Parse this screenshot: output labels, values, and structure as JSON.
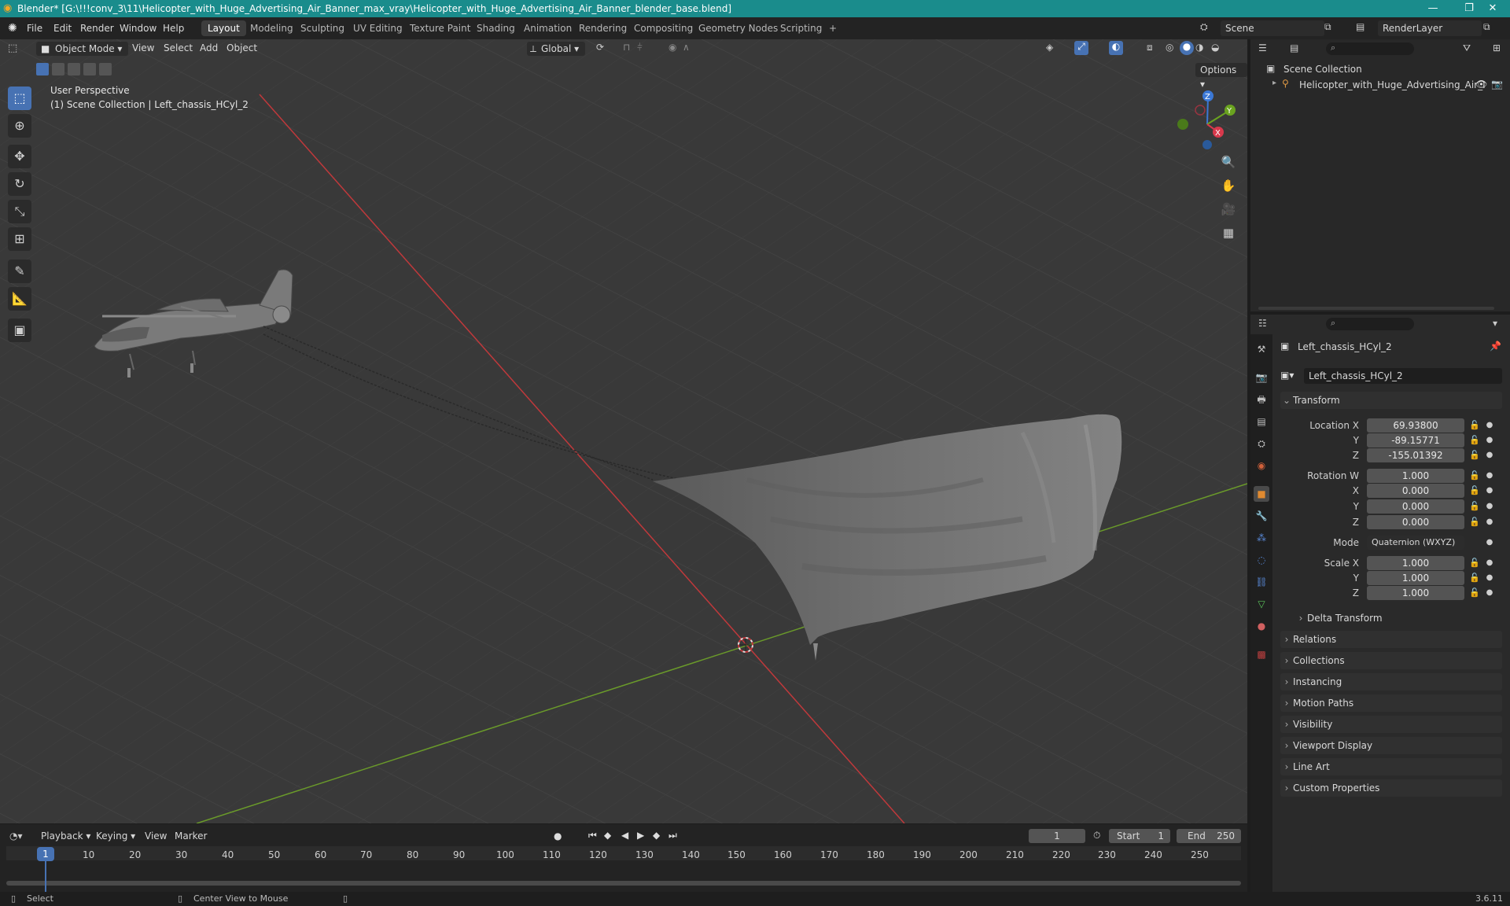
{
  "window": {
    "title": "Blender* [G:\\!!!conv_3\\11\\Helicopter_with_Huge_Advertising_Air_Banner_max_vray\\Helicopter_with_Huge_Advertising_Air_Banner_blender_base.blend]",
    "minimize": "—",
    "maximize": "❐",
    "close": "✕"
  },
  "menu": [
    "File",
    "Edit",
    "Render",
    "Window",
    "Help"
  ],
  "workspaces": [
    "Layout",
    "Modeling",
    "Sculpting",
    "UV Editing",
    "Texture Paint",
    "Shading",
    "Animation",
    "Rendering",
    "Compositing",
    "Geometry Nodes",
    "Scripting",
    "+"
  ],
  "scene": {
    "label": "Scene",
    "render_layer": "RenderLayer"
  },
  "viewport_header": {
    "mode": "Object Mode",
    "menus": [
      "View",
      "Select",
      "Add",
      "Object"
    ],
    "orientation": "Global",
    "options": "Options"
  },
  "viewport": {
    "perspective": "User Perspective",
    "collection_info": "(1) Scene Collection | Left_chassis_HCyl_2",
    "gizmo": {
      "x": "X",
      "y": "Y",
      "z": "Z"
    }
  },
  "outliner": {
    "root": "Scene Collection",
    "item": "Helicopter_with_Huge_Advertising_Air_I"
  },
  "properties": {
    "object_name": "Left_chassis_HCyl_2",
    "data_name": "Left_chassis_HCyl_2",
    "transform_label": "Transform",
    "location_label": "Location X",
    "location": [
      "69.93800",
      "-89.15771",
      "-155.01392"
    ],
    "rotation_label": "Rotation W",
    "rotation": [
      "1.000",
      "0.000",
      "0.000",
      "0.000"
    ],
    "axis_y": "Y",
    "axis_z": "Z",
    "axis_x": "X",
    "mode_label": "Mode",
    "mode_value": "Quaternion (WXYZ)",
    "scale_label": "Scale X",
    "scale": [
      "1.000",
      "1.000",
      "1.000"
    ],
    "delta": "Delta Transform",
    "panels": [
      "Relations",
      "Collections",
      "Instancing",
      "Motion Paths",
      "Visibility",
      "Viewport Display",
      "Line Art",
      "Custom Properties"
    ]
  },
  "timeline": {
    "menus": [
      "Playback",
      "Keying",
      "View",
      "Marker"
    ],
    "current_frame": "1",
    "start_label": "Start",
    "start": "1",
    "end_label": "End",
    "end": "250",
    "ticks": [
      "1",
      "10",
      "20",
      "30",
      "40",
      "50",
      "60",
      "70",
      "80",
      "90",
      "100",
      "110",
      "120",
      "130",
      "140",
      "150",
      "160",
      "170",
      "180",
      "190",
      "200",
      "210",
      "220",
      "230",
      "240",
      "250"
    ]
  },
  "status": {
    "select": "Select",
    "center": "Center View to Mouse",
    "version": "3.6.11"
  },
  "colors": {
    "accent": "#4772b3",
    "titlebar": "#1a8c8c",
    "x_axis": "#c0393b",
    "y_axis": "#6a9a2a"
  }
}
